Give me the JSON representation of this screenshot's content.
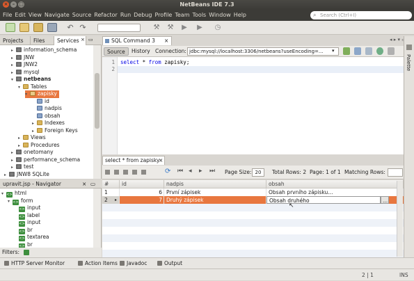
{
  "window": {
    "title": "NetBeans IDE 7.3"
  },
  "menu": [
    "File",
    "Edit",
    "View",
    "Navigate",
    "Source",
    "Refactor",
    "Run",
    "Debug",
    "Profile",
    "Team",
    "Tools",
    "Window",
    "Help"
  ],
  "search": {
    "placeholder": "Search (Ctrl+I)"
  },
  "left_tabs": [
    "Projects",
    "Files",
    "Services"
  ],
  "tree": [
    {
      "label": "information_schema",
      "icon": "database",
      "depth": 1,
      "toggle": "collapsed"
    },
    {
      "label": "JNW",
      "icon": "database",
      "depth": 1,
      "toggle": "collapsed"
    },
    {
      "label": "JNW2",
      "icon": "database",
      "depth": 1,
      "toggle": "collapsed"
    },
    {
      "label": "mysql",
      "icon": "database",
      "depth": 1,
      "toggle": "collapsed"
    },
    {
      "label": "netbeans",
      "icon": "database",
      "depth": 1,
      "toggle": "expanded",
      "bold": true
    },
    {
      "label": "Tables",
      "icon": "folder",
      "depth": 2,
      "toggle": "expanded"
    },
    {
      "label": "zapisky",
      "icon": "table",
      "depth": 3,
      "toggle": "expanded",
      "selected": true
    },
    {
      "label": "id",
      "icon": "column",
      "depth": 4,
      "toggle": "none"
    },
    {
      "label": "nadpis",
      "icon": "column",
      "depth": 4,
      "toggle": "none"
    },
    {
      "label": "obsah",
      "icon": "column",
      "depth": 4,
      "toggle": "none"
    },
    {
      "label": "Indexes",
      "icon": "folder",
      "depth": 4,
      "toggle": "collapsed"
    },
    {
      "label": "Foreign Keys",
      "icon": "folder",
      "depth": 4,
      "toggle": "collapsed"
    },
    {
      "label": "Views",
      "icon": "folder",
      "depth": 2,
      "toggle": "collapsed"
    },
    {
      "label": "Procedures",
      "icon": "folder",
      "depth": 2,
      "toggle": "collapsed"
    },
    {
      "label": "onetomany",
      "icon": "database",
      "depth": 1,
      "toggle": "collapsed"
    },
    {
      "label": "performance_schema",
      "icon": "database",
      "depth": 1,
      "toggle": "collapsed"
    },
    {
      "label": "test",
      "icon": "database",
      "depth": 1,
      "toggle": "collapsed"
    },
    {
      "label": "JNW8 SQLite",
      "icon": "database",
      "depth": 0,
      "toggle": "collapsed"
    }
  ],
  "navigator": {
    "title": "upravit.jsp - Navigator",
    "items": [
      {
        "label": "html",
        "depth": 0,
        "toggle": "expanded"
      },
      {
        "label": "form",
        "depth": 1,
        "toggle": "expanded"
      },
      {
        "label": "input",
        "depth": 2,
        "toggle": "none"
      },
      {
        "label": "label",
        "depth": 2,
        "toggle": "none"
      },
      {
        "label": "input",
        "depth": 2,
        "toggle": "none"
      },
      {
        "label": "br",
        "depth": 2,
        "toggle": "none"
      },
      {
        "label": "textarea",
        "depth": 2,
        "toggle": "none"
      },
      {
        "label": "br",
        "depth": 2,
        "toggle": "none"
      }
    ],
    "filters_label": "Filters:"
  },
  "editor": {
    "tab": "SQL Command 3",
    "source_btn": "Source",
    "history_btn": "History",
    "connection_label": "Connection:",
    "connection_value": "jdbc:mysql://localhost:3306/netbeans?useEncoding=...",
    "lines": [
      "1",
      "2"
    ],
    "code_keyword_1": "select",
    "code_rest_1": " * ",
    "code_keyword_2": "from",
    "code_rest_2": " zapisky;"
  },
  "results": {
    "tab": "select * from zapisky",
    "page_size_label": "Page Size:",
    "page_size": "20",
    "total_rows": "Total Rows: 2",
    "page_info": "Page: 1 of 1",
    "matching_rows": "Matching Rows:",
    "columns": [
      "#",
      "id",
      "nadpis",
      "obsah"
    ],
    "rows": [
      {
        "num": "1",
        "id": "6",
        "nadpis": "První zápisek",
        "obsah": "Obsah prvního zápisku..."
      },
      {
        "num": "2",
        "id": "7",
        "nadpis": "Druhý zápisek",
        "obsah": "Obsah druhého"
      }
    ],
    "ellipsis_btn": "..."
  },
  "bottom_tabs": [
    "HTTP Server Monitor",
    "Action Items",
    "Javadoc",
    "Output"
  ],
  "palette_label": "Palette",
  "status": {
    "position": "2 | 1",
    "mode": "INS"
  },
  "colors": {
    "selected_row": "#e8773f",
    "title_bg": "#3c3b37",
    "accent": "#dd4814"
  }
}
